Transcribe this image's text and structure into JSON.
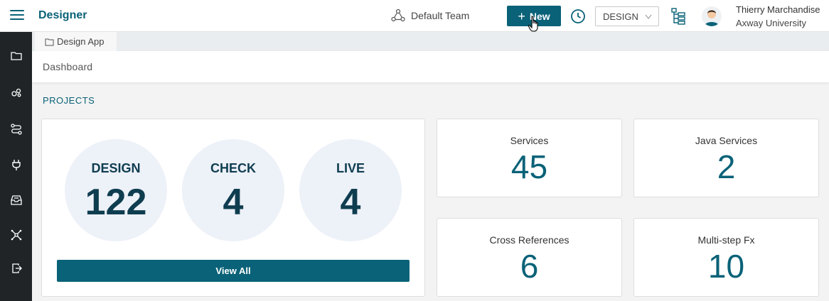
{
  "header": {
    "app_title": "Designer",
    "team": "Default Team",
    "new_label": "New",
    "environment": "DESIGN",
    "user_name": "Thierry Marchandise",
    "user_org": "Axway University"
  },
  "tab": {
    "label": "Design App"
  },
  "breadcrumb": "Dashboard",
  "section_title": "PROJECTS",
  "projects": {
    "design": {
      "label": "DESIGN",
      "count": "122"
    },
    "check": {
      "label": "CHECK",
      "count": "4"
    },
    "live": {
      "label": "LIVE",
      "count": "4"
    },
    "view_all": "View All"
  },
  "stats": {
    "services": {
      "label": "Services",
      "value": "45"
    },
    "java_services": {
      "label": "Java Services",
      "value": "2"
    },
    "cross_references": {
      "label": "Cross References",
      "value": "6"
    },
    "multistep": {
      "label": "Multi-step Fx",
      "value": "10"
    }
  },
  "colors": {
    "accent": "#0a6278",
    "sidebar": "#202427",
    "circle_bg": "#edf1f8",
    "circle_text": "#0f3d50"
  },
  "sidebar_icons": [
    "folder-icon",
    "services-icon",
    "flow-icon",
    "plug-icon",
    "inbox-icon",
    "network-icon",
    "export-icon"
  ]
}
